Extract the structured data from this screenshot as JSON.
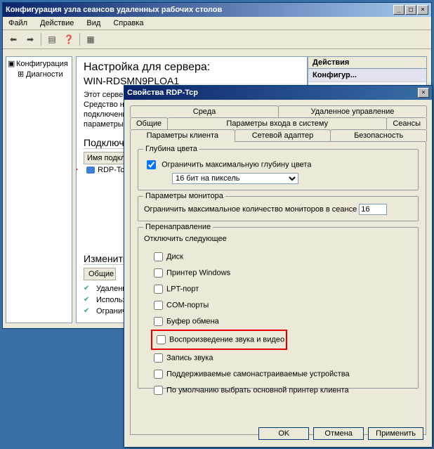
{
  "main_window": {
    "title": "Конфигурация узла сеансов удаленных рабочих столов",
    "menu": {
      "file": "Файл",
      "action": "Действие",
      "view": "Вид",
      "help": "Справка"
    }
  },
  "tree": {
    "root": "Конфигурация",
    "child": "Диагности"
  },
  "content": {
    "heading": "Настройка для сервера:",
    "server": "WIN-RDSMN9PLOA1",
    "p1": "Этот сервер настрое",
    "p2": "Средство настройки",
    "p3": "подключений, измен",
    "p4": "параметры отдельно",
    "h_conn": "Подключения",
    "col_name": "Имя подключения",
    "conn": "RDP-Tcp",
    "h_change": "Изменить пар",
    "h_general": "Общие",
    "g1": "Удаление време",
    "g2": "Использовать о",
    "g3": "Ограничить пол"
  },
  "actions": {
    "header": "Действия",
    "row": "Конфигур..."
  },
  "dialog": {
    "title": "Свойства RDP-Tcp",
    "tabs_row1": {
      "env": "Среда",
      "remote": "Удаленное управление"
    },
    "tabs_row2": {
      "general": "Общие",
      "logon": "Параметры входа в систему",
      "sessions": "Сеансы"
    },
    "tabs_row3": {
      "client": "Параметры клиента",
      "net": "Сетевой адаптер",
      "security": "Безопасность"
    },
    "color": {
      "legend": "Глубина цвета",
      "limit": "Ограничить максимальную глубину цвета",
      "value": "16 бит на пиксель"
    },
    "monitor": {
      "legend": "Параметры монитора",
      "label": "Ограничить максимальное количество мониторов в сеансе",
      "value": "16"
    },
    "redirect": {
      "legend": "Перенаправление",
      "disable": "Отключить следующее",
      "items": [
        "Диск",
        "Принтер Windows",
        "LPT-порт",
        "COM-порты",
        "Буфер обмена",
        "Воспроизведение звука и видео",
        "Запись звука",
        "Поддерживаемые самонастраиваемые устройства",
        "По умолчанию выбрать основной принтер клиента"
      ],
      "highlight_index": 5
    },
    "buttons": {
      "ok": "OK",
      "cancel": "Отмена",
      "apply": "Применить"
    }
  }
}
